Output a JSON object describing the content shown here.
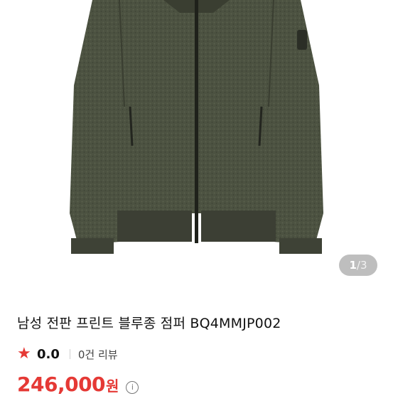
{
  "gallery": {
    "current": "1",
    "separator": "/",
    "total": "3"
  },
  "product": {
    "title": "남성 전판 프린트 블루종 점퍼 BQ4MMJP002",
    "rating": "0.0",
    "review_count": "0건 리뷰",
    "price": "246,000",
    "currency": "원"
  },
  "colors": {
    "accent": "#e53935",
    "jacket": "#4a4f3e"
  },
  "icons": {
    "rating": "star-icon",
    "price_info": "info-icon"
  }
}
